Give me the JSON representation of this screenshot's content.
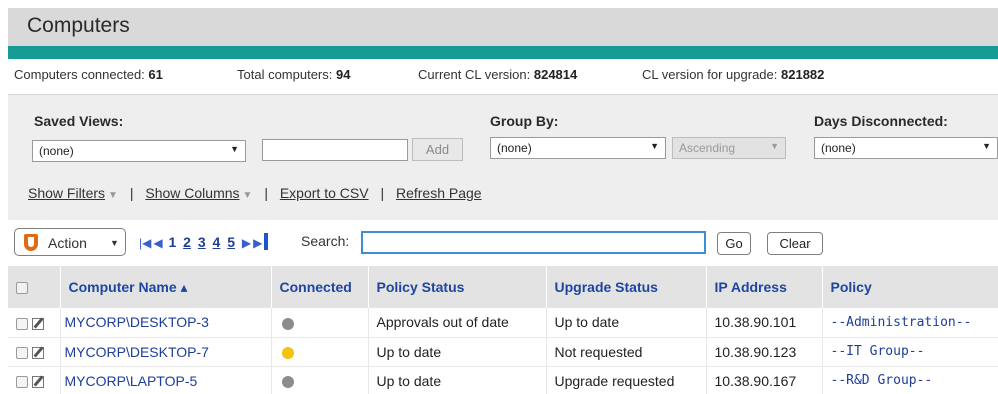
{
  "header": {
    "title": "Computers"
  },
  "stats": {
    "connected_label": "Computers connected:",
    "connected_value": "61",
    "total_label": "Total computers:",
    "total_value": "94",
    "cl_label": "Current CL version:",
    "cl_value": "824814",
    "upgrade_label": "CL version for upgrade:",
    "upgrade_value": "821882"
  },
  "filters": {
    "saved_views_label": "Saved Views:",
    "saved_views_value": "(none)",
    "add_label": "Add",
    "group_by_label": "Group By:",
    "group_by_value": "(none)",
    "sort_value": "Ascending",
    "days_label": "Days Disconnected:",
    "days_value": "(none)",
    "show_filters": "Show Filters",
    "show_columns": "Show Columns",
    "export_csv": "Export to CSV",
    "refresh_page": "Refresh Page"
  },
  "toolbar": {
    "action_label": "Action",
    "pages": [
      "1",
      "2",
      "3",
      "4",
      "5"
    ],
    "search_label": "Search:",
    "search_value": "",
    "go_label": "Go",
    "clear_label": "Clear"
  },
  "table": {
    "headers": {
      "name": "Computer Name ▴",
      "connected": "Connected",
      "policy_status": "Policy Status",
      "upgrade_status": "Upgrade Status",
      "ip": "IP Address",
      "policy": "Policy"
    },
    "rows": [
      {
        "name": "MYCORP\\DESKTOP-3",
        "connected_color": "#8c8c8c",
        "policy_status": "Approvals out of date",
        "upgrade_status": "Up to date",
        "ip": "10.38.90.101",
        "policy": "--Administration--"
      },
      {
        "name": "MYCORP\\DESKTOP-7",
        "connected_color": "#f2c40f",
        "policy_status": "Up to date",
        "upgrade_status": "Not requested",
        "ip": "10.38.90.123",
        "policy": "--IT Group--"
      },
      {
        "name": "MYCORP\\LAPTOP-5",
        "connected_color": "#8c8c8c",
        "policy_status": "Up to date",
        "upgrade_status": "Upgrade requested",
        "ip": "10.38.90.167",
        "policy": "--R&D Group--"
      }
    ]
  }
}
